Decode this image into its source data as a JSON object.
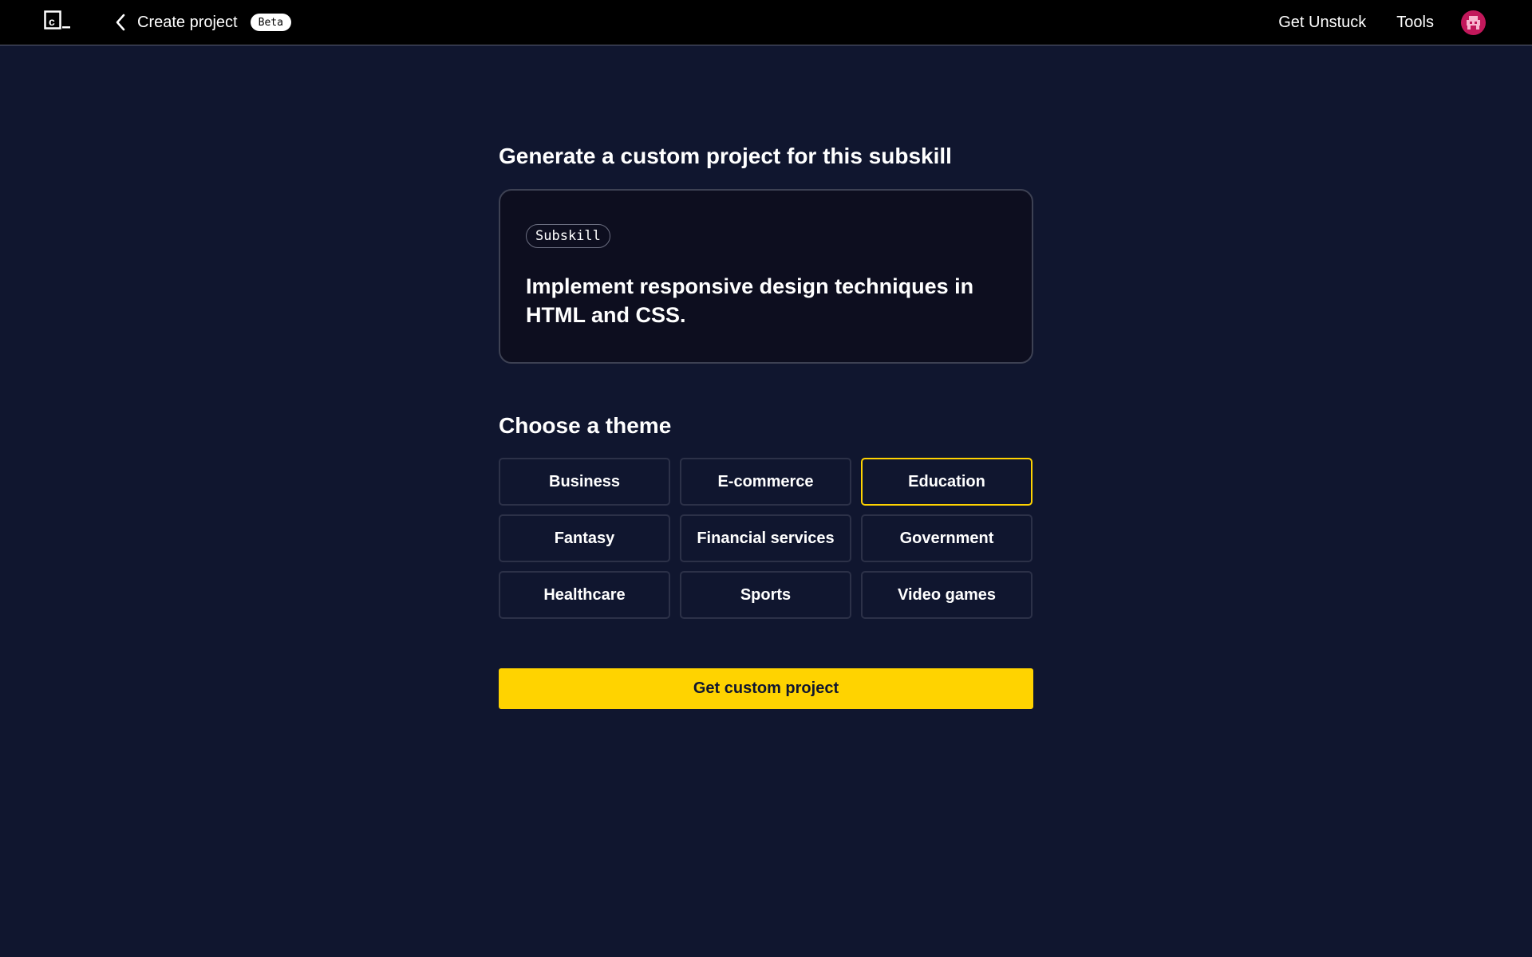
{
  "header": {
    "logo_icon": "codecademy-logo-icon",
    "back_icon": "chevron-left-icon",
    "back_label": "Create project",
    "badge": "Beta",
    "nav": {
      "get_unstuck": "Get Unstuck",
      "tools": "Tools"
    },
    "avatar_icon": "user-avatar-icon",
    "avatar_color": "#c2185b"
  },
  "main": {
    "generate_heading": "Generate a custom project for this subskill",
    "subskill_card": {
      "tag": "Subskill",
      "text": "Implement responsive design techniques in HTML and CSS."
    },
    "theme_heading": "Choose a theme",
    "themes": [
      {
        "label": "Business",
        "selected": false
      },
      {
        "label": "E-commerce",
        "selected": false
      },
      {
        "label": "Education",
        "selected": true
      },
      {
        "label": "Fantasy",
        "selected": false
      },
      {
        "label": "Financial services",
        "selected": false
      },
      {
        "label": "Government",
        "selected": false
      },
      {
        "label": "Healthcare",
        "selected": false
      },
      {
        "label": "Sports",
        "selected": false
      },
      {
        "label": "Video games",
        "selected": false
      }
    ],
    "cta_label": "Get custom project"
  },
  "colors": {
    "background": "#10162f",
    "accent": "#ffd300",
    "topbar": "#000000"
  }
}
